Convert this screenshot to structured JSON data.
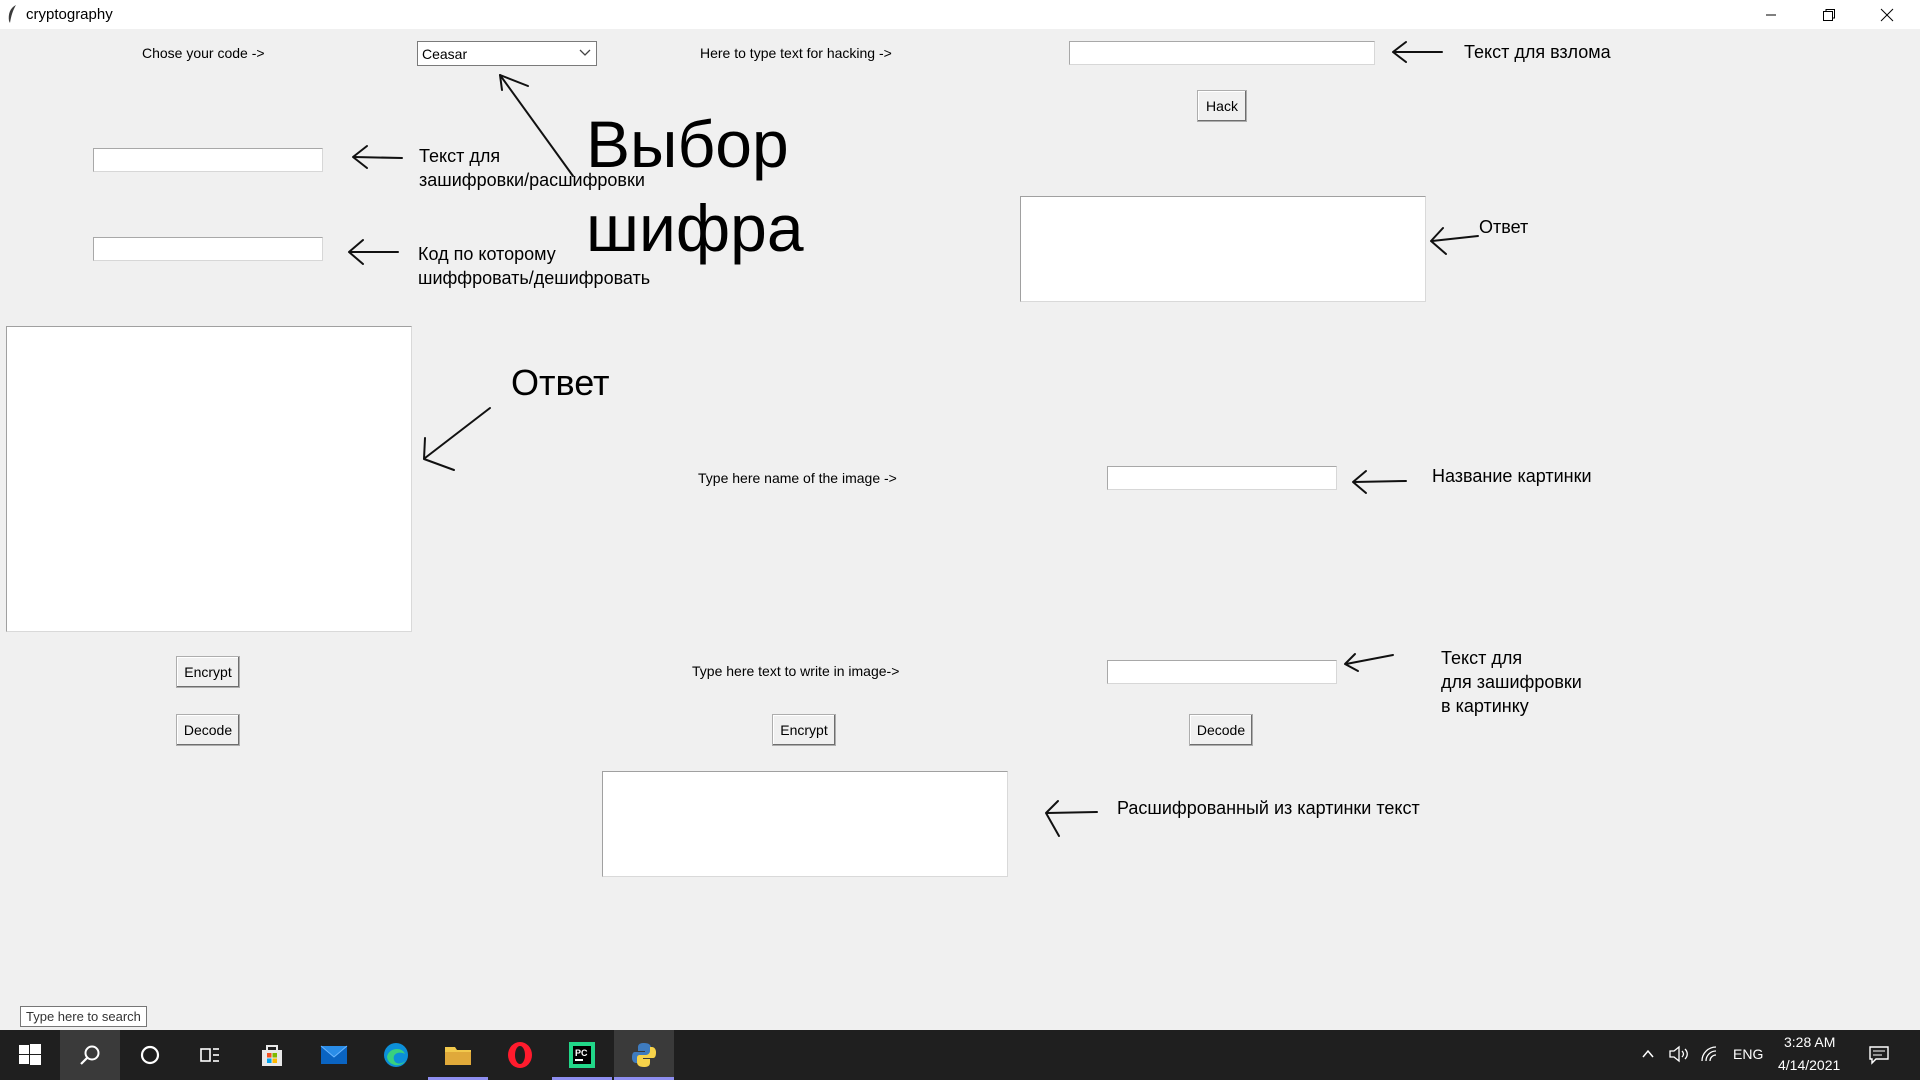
{
  "window": {
    "title": "cryptography"
  },
  "labels": {
    "choose_code": "Chose your code ->",
    "hack_text": "Here to type text for hacking ->",
    "image_name": "Type here name of the image ->",
    "image_text": "Type here text to write in image->"
  },
  "combo": {
    "value": "Ceasar"
  },
  "buttons": {
    "hack": "Hack",
    "encrypt": "Encrypt",
    "decode": "Decode",
    "img_encrypt": "Encrypt",
    "img_decode": "Decode"
  },
  "inputs": {
    "hack_text": "",
    "plain_text": "",
    "key": "",
    "image_name": "",
    "image_text": ""
  },
  "annotations": {
    "hack_text": "Текст для взлома",
    "text_line1": "Текст для",
    "text_line2": "зашифровки/расшифровки",
    "cipher_line1": "Выбор",
    "cipher_line2": "шифра",
    "key_line1": "Код по которому",
    "key_line2": "шиффровать/дешифровать",
    "answer_right": "Ответ",
    "answer_left": "Ответ",
    "image_name": "Название картинки",
    "image_text_line1": "Текст для",
    "image_text_line2": "для зашифровки",
    "image_text_line3": "в картинку",
    "decoded_text": "Расшифрованный из картинки текст"
  },
  "taskbar": {
    "search_tooltip": "Type here to search",
    "icons": [
      "windows-start-icon",
      "search-icon",
      "cortana-icon",
      "task-view-icon",
      "store-icon",
      "mail-icon",
      "edge-icon",
      "file-explorer-icon",
      "opera-icon",
      "pycharm-icon",
      "python-icon"
    ],
    "lang": "ENG",
    "time": "3:28 AM",
    "date": "4/14/2021"
  }
}
